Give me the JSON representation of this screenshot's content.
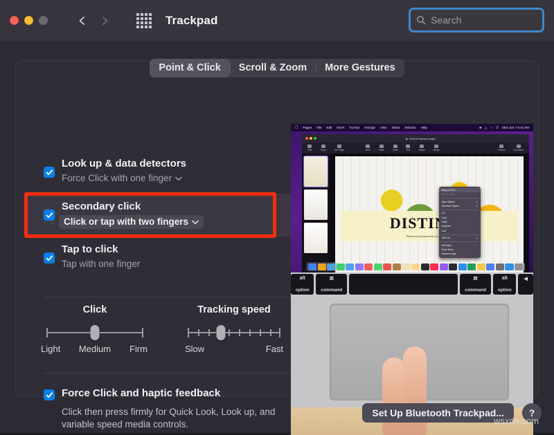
{
  "window": {
    "title": "Trackpad",
    "traffic_lights": [
      "close",
      "minimize",
      "zoom"
    ],
    "nav": {
      "back": "back-arrow",
      "forward": "forward-arrow"
    },
    "grid_icon": "app-grid-icon"
  },
  "search": {
    "placeholder": "Search",
    "value": "",
    "icon": "search-icon",
    "focus_ring_color": "#3f87c8"
  },
  "tabs": [
    {
      "label": "Point & Click",
      "active": true
    },
    {
      "label": "Scroll & Zoom",
      "active": false
    },
    {
      "label": "More Gestures",
      "active": false
    }
  ],
  "options": [
    {
      "title": "Look up & data detectors",
      "sub": "Force Click with one finger",
      "checked": true,
      "has_dropdown": true,
      "popup_style": false,
      "highlighted": false
    },
    {
      "title": "Secondary click",
      "sub": "Click or tap with two fingers",
      "checked": true,
      "has_dropdown": true,
      "popup_style": true,
      "highlighted": true
    },
    {
      "title": "Tap to click",
      "sub": "Tap with one finger",
      "checked": true,
      "has_dropdown": false,
      "popup_style": false,
      "highlighted": false
    }
  ],
  "sliders": [
    {
      "label": "Click",
      "ticks": 3,
      "thumb_index": 1,
      "min_label": "Light",
      "mid_label": "Medium",
      "max_label": "Firm"
    },
    {
      "label": "Tracking speed",
      "ticks": 10,
      "thumb_index": 3,
      "min_label": "Slow",
      "mid_label": "",
      "max_label": "Fast"
    }
  ],
  "force_click": {
    "title": "Force Click and haptic feedback",
    "sub": "Click then press firmly for Quick Look, Look up, and variable speed media controls.",
    "checked": true
  },
  "preview": {
    "name": "secondary-click-demo-video",
    "menubar": [
      "Pages",
      "File",
      "Edit",
      "Insert",
      "Format",
      "Arrange",
      "View",
      "Share",
      "Window",
      "Help"
    ],
    "clock": "Mon Jun 7  9:41 AM",
    "doc_title": "Distinct Market.pages",
    "doc_headline": "DISTINCT",
    "doc_tagline": "Home-style preparations for your kitchen",
    "context_menu": [
      "Bring to Front",
      "Send to Back",
      "Align Objects",
      "Distribute Objects",
      "Cut",
      "Copy",
      "Paste",
      "Duplicate",
      "Lock",
      "Add Link",
      "Edit Mask",
      "Reset Mask",
      "Replace Image"
    ],
    "keys": [
      "alt option",
      "command",
      "space",
      "command",
      "alt option",
      "eject"
    ]
  },
  "bottom": {
    "setup_button": "Set Up Bluetooth Trackpad...",
    "help_button": "?",
    "watermark": "wsxdn.com"
  },
  "colors": {
    "accent_blue": "#0a7cf0",
    "highlight_red": "#fe2a10",
    "window_bg": "#2c2b33",
    "panel_bg": "#2f2e36",
    "titlebar_bg": "#36343c"
  }
}
